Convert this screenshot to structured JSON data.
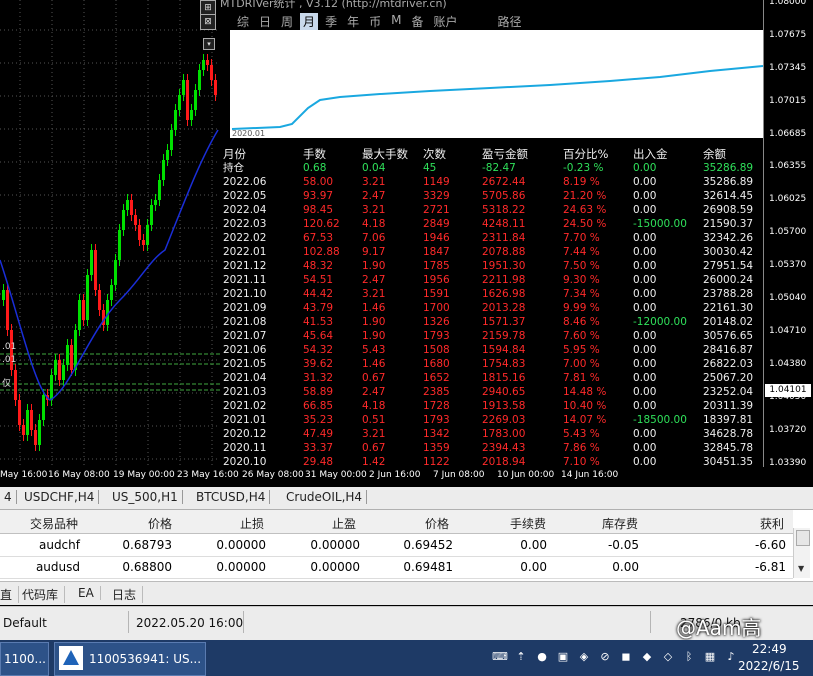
{
  "chart": {
    "prices": [
      "1.08000",
      "1.07675",
      "1.07345",
      "1.07015",
      "1.06685",
      "1.06355",
      "1.06025",
      "1.05700",
      "1.05370",
      "1.05040",
      "1.04710",
      "1.04380",
      "1.04050",
      "1.03720",
      "1.03390"
    ],
    "current_price": "1.04101",
    "times": [
      "May 16:00",
      "16 May 08:00",
      "19 May 00:00",
      "23 May 16:00",
      "26 May 08:00",
      "31 May 00:00",
      "2 Jun 16:00",
      "7 Jun 08:00",
      "10 Jun 00:00",
      "14 Jun 16:00"
    ],
    "left_labels": [
      ".01",
      ".01",
      "仅"
    ],
    "colors": {
      "bull": "#00e000",
      "bear": "#ff1a1a",
      "ma": "#1a2ed8",
      "curve": "#1aa8e0"
    }
  },
  "panel": {
    "title": "MTDRIVer统计 , V3.12 (http://mtdriver.cn)",
    "tabs": [
      "综",
      "日",
      "周",
      "月",
      "季",
      "年",
      "币",
      "M",
      "备",
      "账户",
      "路径"
    ],
    "active_tab": "月",
    "curve_label": "2020.01",
    "headers": [
      "月份",
      "手数",
      "最大手数",
      "次数",
      "盈亏金额",
      "百分比%",
      "出入金",
      "余额"
    ],
    "holding": [
      "持仓",
      "0.68",
      "0.04",
      "45",
      "-82.47",
      "-0.23 %",
      "0.00",
      "35286.89"
    ],
    "rows": [
      [
        "2022.06",
        "58.00",
        "3.21",
        "1149",
        "2672.44",
        "8.19 %",
        "0.00",
        "35286.89"
      ],
      [
        "2022.05",
        "93.97",
        "2.47",
        "3329",
        "5705.86",
        "21.20 %",
        "0.00",
        "32614.45"
      ],
      [
        "2022.04",
        "98.45",
        "3.21",
        "2721",
        "5318.22",
        "24.63 %",
        "0.00",
        "26908.59"
      ],
      [
        "2022.03",
        "120.62",
        "4.18",
        "2849",
        "4248.11",
        "24.50 %",
        "-15000.00",
        "21590.37"
      ],
      [
        "2022.02",
        "67.53",
        "7.06",
        "1946",
        "2311.84",
        "7.70 %",
        "0.00",
        "32342.26"
      ],
      [
        "2022.01",
        "102.88",
        "9.17",
        "1847",
        "2078.88",
        "7.44 %",
        "0.00",
        "30030.42"
      ],
      [
        "2021.12",
        "48.32",
        "1.90",
        "1785",
        "1951.30",
        "7.50 %",
        "0.00",
        "27951.54"
      ],
      [
        "2021.11",
        "54.51",
        "2.47",
        "1956",
        "2211.98",
        "9.30 %",
        "0.00",
        "26000.24"
      ],
      [
        "2021.10",
        "44.42",
        "3.21",
        "1591",
        "1626.98",
        "7.34 %",
        "0.00",
        "23788.28"
      ],
      [
        "2021.09",
        "43.79",
        "1.46",
        "1700",
        "2013.28",
        "9.99 %",
        "0.00",
        "22161.30"
      ],
      [
        "2021.08",
        "41.53",
        "1.90",
        "1326",
        "1571.37",
        "8.46 %",
        "-12000.00",
        "20148.02"
      ],
      [
        "2021.07",
        "45.64",
        "1.90",
        "1793",
        "2159.78",
        "7.60 %",
        "0.00",
        "30576.65"
      ],
      [
        "2021.06",
        "54.32",
        "5.43",
        "1508",
        "1594.84",
        "5.95 %",
        "0.00",
        "28416.87"
      ],
      [
        "2021.05",
        "39.62",
        "1.46",
        "1680",
        "1754.83",
        "7.00 %",
        "0.00",
        "26822.03"
      ],
      [
        "2021.04",
        "31.32",
        "0.67",
        "1652",
        "1815.16",
        "7.81 %",
        "0.00",
        "25067.20"
      ],
      [
        "2021.03",
        "58.89",
        "2.47",
        "2385",
        "2940.65",
        "14.48 %",
        "0.00",
        "23252.04"
      ],
      [
        "2021.02",
        "66.85",
        "4.18",
        "1728",
        "1913.58",
        "10.40 %",
        "0.00",
        "20311.39"
      ],
      [
        "2021.01",
        "35.23",
        "0.51",
        "1793",
        "2269.03",
        "14.07 %",
        "-18500.00",
        "18397.81"
      ],
      [
        "2020.12",
        "47.49",
        "3.21",
        "1342",
        "1783.00",
        "5.43 %",
        "0.00",
        "34628.78"
      ],
      [
        "2020.11",
        "33.37",
        "0.67",
        "1359",
        "2394.43",
        "7.86 %",
        "0.00",
        "32845.78"
      ],
      [
        "2020.10",
        "29.48",
        "1.42",
        "1122",
        "2018.94",
        "7.10 %",
        "0.00",
        "30451.35"
      ]
    ]
  },
  "symbol_tabs": [
    "4",
    "USDCHF,H4",
    "US_500,H1",
    "BTCUSD,H4",
    "CrudeOIL,H4"
  ],
  "terminal": {
    "headers": [
      "交易品种",
      "价格",
      "止损",
      "止盈",
      "价格",
      "手续费",
      "库存费",
      "获利"
    ],
    "rows": [
      [
        "audchf",
        "0.68793",
        "0.00000",
        "0.00000",
        "0.69452",
        "0.00",
        "-0.05",
        "-6.60"
      ],
      [
        "audusd",
        "0.68800",
        "0.00000",
        "0.00000",
        "0.69481",
        "0.00",
        "0.00",
        "-6.81"
      ]
    ]
  },
  "term_tabs": [
    "直",
    "代码库",
    "EA",
    "日志"
  ],
  "status": {
    "profile": "Default",
    "datetime": "2022.05.20 16:00",
    "traffic": "2786/0 kb"
  },
  "watermark": "@Aam高",
  "taskbar": {
    "btn1": "1100...",
    "btn2": "1100536941: US...",
    "time": "22:49",
    "date": "2022/6/15"
  }
}
